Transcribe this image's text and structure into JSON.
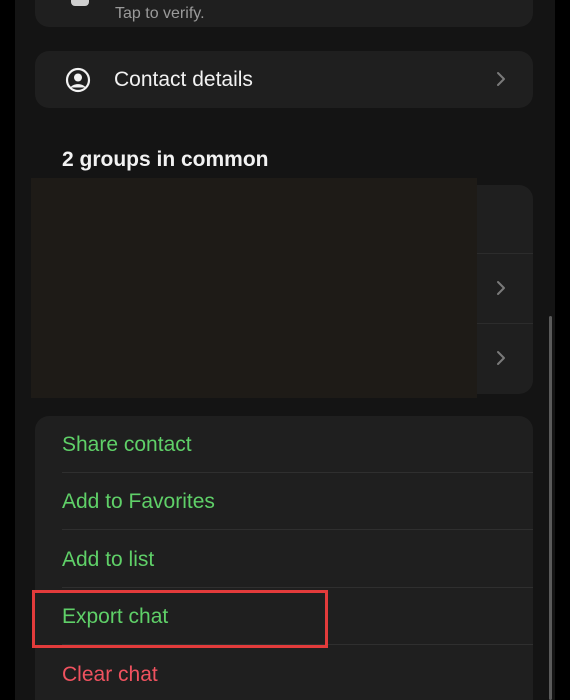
{
  "verify": {
    "subtitle": "Tap to verify."
  },
  "contact_details": {
    "label": "Contact details"
  },
  "groups": {
    "title": "2 groups in common"
  },
  "actions": [
    {
      "label": "Share contact",
      "color": "#5fd068"
    },
    {
      "label": "Add to Favorites",
      "color": "#5fd068"
    },
    {
      "label": "Add to list",
      "color": "#5fd068"
    },
    {
      "label": "Export chat",
      "color": "#5fd068"
    },
    {
      "label": "Clear chat",
      "color": "#f0525f"
    }
  ],
  "colors": {
    "accent_green": "#5fd068",
    "destructive_red": "#f0525f",
    "highlight_red": "#e23b3b"
  }
}
